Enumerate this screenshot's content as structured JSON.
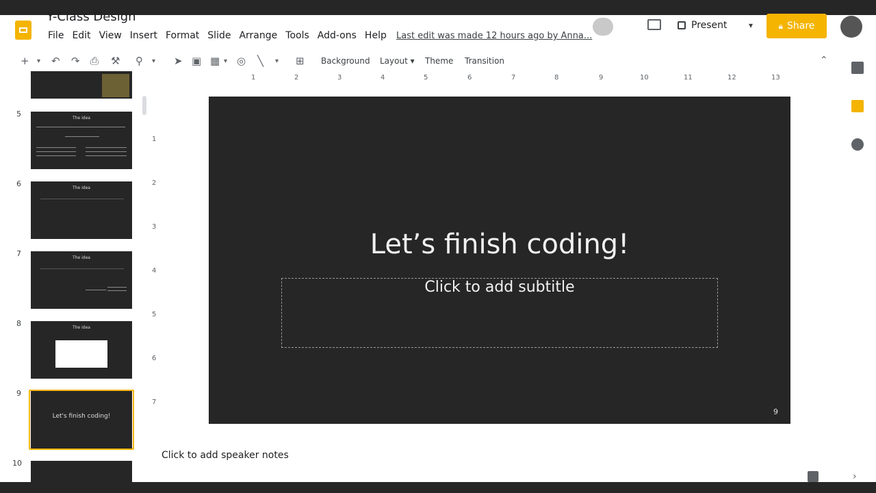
{
  "app": {
    "doc_title": "Y-Class Design",
    "menu": [
      "File",
      "Edit",
      "View",
      "Insert",
      "Format",
      "Slide",
      "Arrange",
      "Tools",
      "Add-ons",
      "Help"
    ],
    "last_edit": "Last edit was made 12 hours ago by Anna..."
  },
  "header": {
    "present_label": "Present",
    "share_label": "Share"
  },
  "toolbar": {
    "background_label": "Background",
    "layout_label": "Layout",
    "theme_label": "Theme",
    "transition_label": "Transition"
  },
  "ruler": {
    "h_ticks": [
      "1",
      "2",
      "3",
      "4",
      "5",
      "6",
      "7",
      "8",
      "9",
      "10",
      "11",
      "12",
      "13"
    ],
    "v_ticks": [
      "1",
      "2",
      "3",
      "4",
      "5",
      "6",
      "7"
    ]
  },
  "filmstrip": {
    "slides": [
      {
        "num": "5",
        "title": "The idea"
      },
      {
        "num": "6",
        "title": "The idea"
      },
      {
        "num": "7",
        "title": "The idea"
      },
      {
        "num": "8",
        "title": "The idea"
      },
      {
        "num": "9",
        "title": "Let's finish coding!"
      },
      {
        "num": "10",
        "title": ""
      }
    ]
  },
  "slide": {
    "title": "Let’s finish coding!",
    "subtitle_placeholder": "Click to add subtitle",
    "number": "9"
  },
  "notes": {
    "placeholder": "Click to add speaker notes"
  },
  "colors": {
    "accent": "#f4b400",
    "slide_background": "#262626",
    "chrome_bar": "#262626"
  }
}
